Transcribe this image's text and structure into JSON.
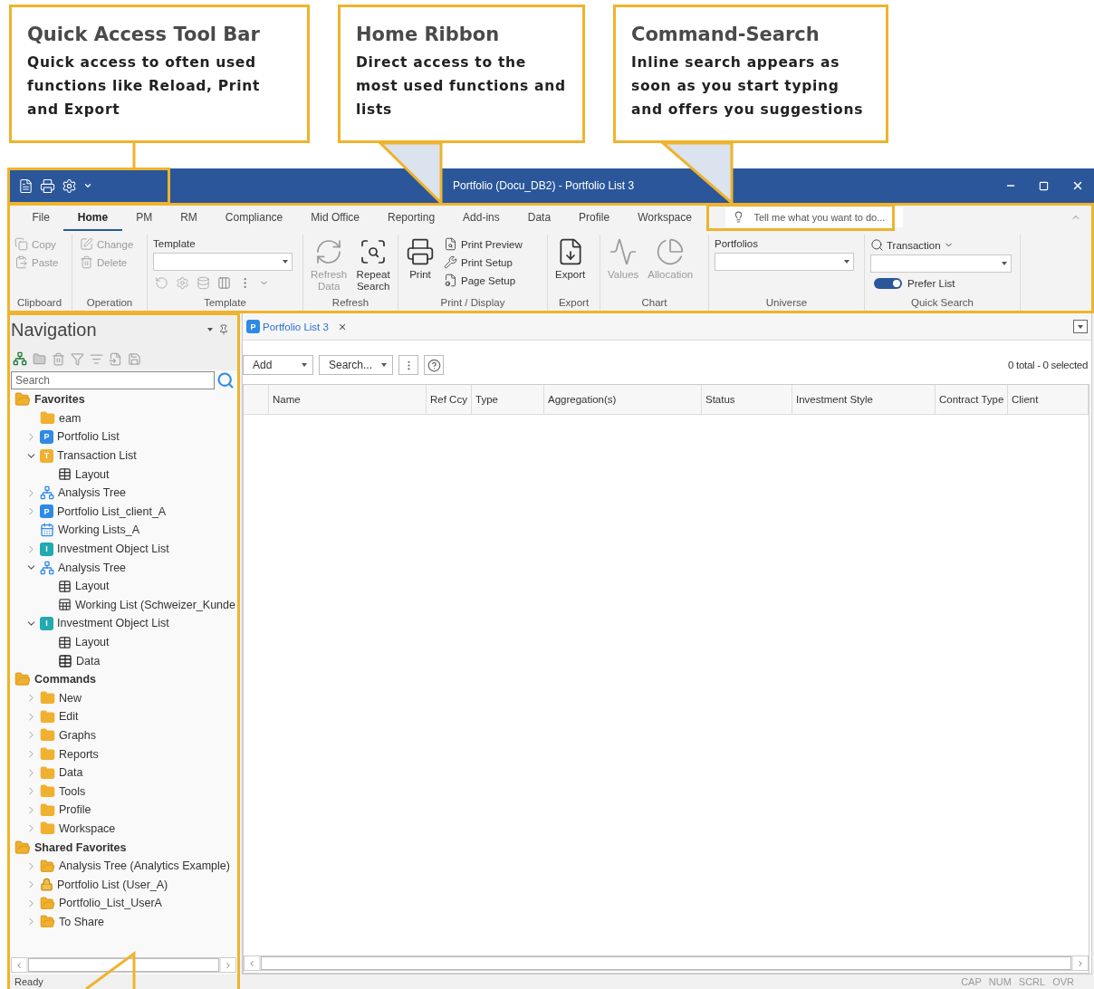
{
  "callouts": [
    {
      "title": "Quick Access Tool Bar",
      "body": "Quick access to often used functions like Reload, Print and Export"
    },
    {
      "title": "Home Ribbon",
      "body": "Direct access to the most used functions and lists"
    },
    {
      "title": "Command-Search",
      "body": "Inline search appears as soon as you start typing and offers you suggestions"
    }
  ],
  "window": {
    "title": "Portfolio (Docu_DB2) - Portfolio List 3"
  },
  "ribbon_tabs": [
    {
      "label": "File",
      "selected": false
    },
    {
      "label": "Home",
      "selected": true
    },
    {
      "label": "PM",
      "selected": false
    },
    {
      "label": "RM",
      "selected": false
    },
    {
      "label": "Compliance",
      "selected": false
    },
    {
      "label": "Mid Office",
      "selected": false
    },
    {
      "label": "Reporting",
      "selected": false
    },
    {
      "label": "Add-ins",
      "selected": false
    },
    {
      "label": "Data",
      "selected": false
    },
    {
      "label": "Profile",
      "selected": false
    },
    {
      "label": "Workspace",
      "selected": false
    }
  ],
  "tell_me": {
    "placeholder": "Tell me what you want to do..."
  },
  "ribbon_groups": [
    {
      "label": "Clipboard",
      "kind": "buttons",
      "items": [
        {
          "label": "Copy",
          "kind": "small",
          "disabled": true
        },
        {
          "label": "Paste",
          "kind": "small",
          "disabled": true
        }
      ]
    },
    {
      "label": "Operation",
      "kind": "buttons",
      "items": [
        {
          "label": "Change",
          "kind": "small",
          "disabled": true
        },
        {
          "label": "Delete",
          "kind": "small",
          "disabled": true
        }
      ]
    },
    {
      "label": "Template",
      "kind": "template",
      "field_label": "Template"
    },
    {
      "label": "Refresh",
      "kind": "buttons",
      "items": [
        {
          "label": "Refresh Data",
          "kind": "large",
          "disabled": true
        },
        {
          "label": "Repeat Search",
          "kind": "large",
          "disabled": false
        }
      ]
    },
    {
      "label": "Print / Display",
      "kind": "buttons",
      "items": [
        {
          "label": "Print",
          "kind": "large",
          "disabled": false
        },
        {
          "label": "Print Preview",
          "kind": "small",
          "disabled": false
        },
        {
          "label": "Print Setup",
          "kind": "small",
          "disabled": false
        },
        {
          "label": "Page Setup",
          "kind": "small",
          "disabled": false
        }
      ]
    },
    {
      "label": "Export",
      "kind": "buttons",
      "items": [
        {
          "label": "Export",
          "kind": "large",
          "disabled": false
        }
      ]
    },
    {
      "label": "Chart",
      "kind": "buttons",
      "items": [
        {
          "label": "Values",
          "kind": "large",
          "disabled": true
        },
        {
          "label": "Allocation",
          "kind": "large",
          "disabled": true
        }
      ]
    },
    {
      "label": "Universe",
      "kind": "combo",
      "field_label": "Portfolios"
    },
    {
      "label": "Quick Search",
      "kind": "quicksearch",
      "field_label": "Transaction",
      "toggle": {
        "label": "Prefer List",
        "on": true
      }
    }
  ],
  "navigation": {
    "title": "Navigation",
    "search": {
      "placeholder": "Search"
    },
    "sections": [
      {
        "label": "Favorites",
        "expanded": true,
        "children": [
          {
            "label": "eam",
            "kind": "folder"
          },
          {
            "label": "Portfolio List",
            "kind": "portfolio",
            "badge": "P",
            "expanded": false
          },
          {
            "label": "Transaction List",
            "kind": "transaction",
            "badge": "T",
            "expanded": true,
            "children": [
              {
                "label": "Layout",
                "kind": "layout"
              }
            ]
          },
          {
            "label": "Analysis Tree",
            "kind": "tree",
            "expanded": false
          },
          {
            "label": "Portfolio List_client_A",
            "kind": "portfolio",
            "badge": "P",
            "expanded": false
          },
          {
            "label": "Working Lists_A",
            "kind": "working"
          },
          {
            "label": "Investment Object List",
            "kind": "investment",
            "badge": "I",
            "expanded": false
          },
          {
            "label": "Analysis Tree",
            "kind": "tree",
            "expanded": true,
            "children": [
              {
                "label": "Layout",
                "kind": "layout"
              },
              {
                "label": "Working List (Schweizer_Kunde",
                "kind": "starred"
              }
            ]
          },
          {
            "label": "Investment Object List",
            "kind": "investment",
            "badge": "I",
            "expanded": true,
            "children": [
              {
                "label": "Layout",
                "kind": "layout"
              },
              {
                "label": "Data",
                "kind": "data"
              }
            ]
          }
        ]
      },
      {
        "label": "Commands",
        "expanded": true,
        "children": [
          {
            "label": "New",
            "kind": "folder",
            "expanded": false
          },
          {
            "label": "Edit",
            "kind": "folder",
            "expanded": false
          },
          {
            "label": "Graphs",
            "kind": "folder",
            "expanded": false
          },
          {
            "label": "Reports",
            "kind": "folder",
            "expanded": false
          },
          {
            "label": "Data",
            "kind": "folder",
            "expanded": false
          },
          {
            "label": "Tools",
            "kind": "folder",
            "expanded": false
          },
          {
            "label": "Profile",
            "kind": "folder",
            "expanded": false
          },
          {
            "label": "Workspace",
            "kind": "folder",
            "expanded": false
          }
        ]
      },
      {
        "label": "Shared Favorites",
        "expanded": true,
        "children": [
          {
            "label": "Analysis Tree (Analytics Example)",
            "kind": "shared",
            "expanded": false
          },
          {
            "label": "Portfolio List (User_A)",
            "kind": "locked",
            "expanded": false
          },
          {
            "label": "Portfolio_List_UserA",
            "kind": "shared",
            "expanded": false
          },
          {
            "label": "To Share",
            "kind": "shared",
            "expanded": false
          }
        ]
      }
    ]
  },
  "document_tab": {
    "label": "Portfolio List 3",
    "badge": "P",
    "close": "×"
  },
  "toolbar": {
    "add": "Add",
    "search": "Search...",
    "summary": "0 total - 0 selected"
  },
  "table": {
    "columns": [
      "Name",
      "Ref Ccy",
      "Type",
      "Aggregation(s)",
      "Status",
      "Investment Style",
      "Contract Type",
      "Client"
    ]
  },
  "status_bar": {
    "left": "Ready",
    "indicators": [
      "CAP",
      "NUM",
      "SCRL",
      "OVR"
    ]
  }
}
